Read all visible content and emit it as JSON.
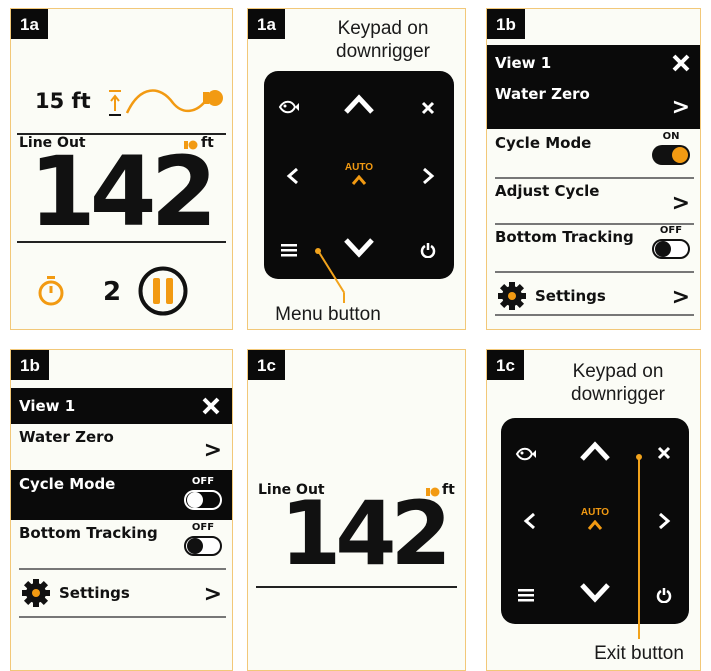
{
  "panels": {
    "p1": {
      "tag": "1a",
      "depth": "15 ft",
      "line_out": "Line Out",
      "unit": "ft",
      "value": "142",
      "count": "2"
    },
    "p2": {
      "tag": "1a",
      "caption": "Keypad on\ndownrigger",
      "auto": "AUTO",
      "callout": "Menu button"
    },
    "p3": {
      "tag": "1b",
      "header": "View 1",
      "close": "X",
      "rows": [
        {
          "label": "Water Zero",
          "arrow": ">"
        },
        {
          "label": "Cycle Mode",
          "state": "ON"
        },
        {
          "label": "Adjust Cycle",
          "arrow": ">"
        },
        {
          "label": "Bottom Tracking",
          "state": "OFF"
        },
        {
          "label": "Settings",
          "arrow": ">"
        }
      ]
    },
    "p4": {
      "tag": "1b",
      "header": "View 1",
      "close": "X",
      "rows": [
        {
          "label": "Water Zero",
          "arrow": ">"
        },
        {
          "label": "Cycle Mode",
          "state": "OFF"
        },
        {
          "label": "Bottom Tracking",
          "state": "OFF"
        },
        {
          "label": "Settings",
          "arrow": ">"
        }
      ]
    },
    "p5": {
      "tag": "1c",
      "line_out": "Line Out",
      "unit": "ft",
      "value": "142"
    },
    "p6": {
      "tag": "1c",
      "caption": "Keypad on\ndownrigger",
      "auto": "AUTO",
      "callout": "Exit button"
    }
  },
  "colors": {
    "accent": "#f29a12",
    "border": "#f2c879",
    "black": "#0a0a0a"
  },
  "icons": [
    "fish-icon",
    "up-arrow-icon",
    "down-arrow-icon",
    "left-arrow-icon",
    "right-arrow-icon",
    "close-icon",
    "menu-icon",
    "power-icon",
    "timer-icon",
    "pause-icon",
    "gear-icon",
    "weight-icon"
  ]
}
